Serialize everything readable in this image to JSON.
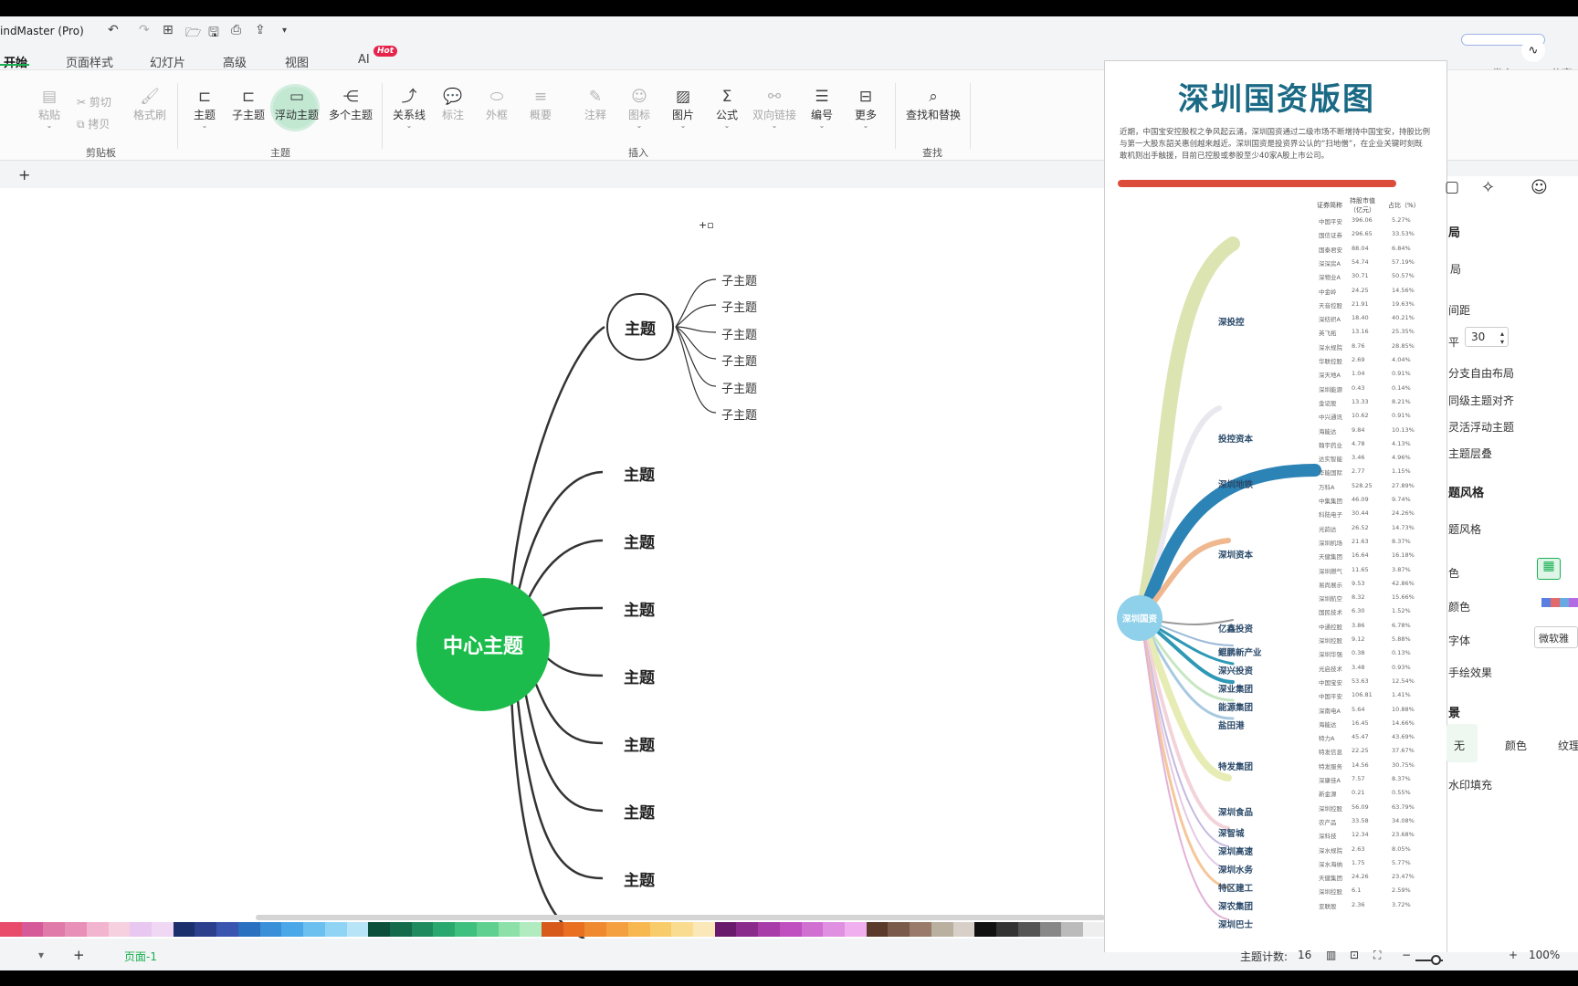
{
  "app": {
    "title": "indMaster (Pro)"
  },
  "quick_access": {
    "undo": "↶",
    "redo": "↷",
    "new": "⊞",
    "open": "🗁",
    "save": "🖫",
    "print": "⎙",
    "export": "⇪",
    "more": "▾"
  },
  "menu_tabs": [
    "开始",
    "页面样式",
    "幻灯片",
    "高级",
    "视图",
    "AI"
  ],
  "hot_badge": "Hot",
  "top_right": {
    "publish": "发布",
    "share": "分享"
  },
  "ribbon": {
    "clipboard": {
      "paste": "粘贴",
      "cut": "剪切",
      "copy": "拷贝",
      "format_painter": "格式刷",
      "label": "剪贴板"
    },
    "topic": {
      "topic": "主题",
      "subtopic": "子主题",
      "floating": "浮动主题",
      "multiple": "多个主题",
      "label": "主题"
    },
    "insert": {
      "relation": "关系线",
      "callout": "标注",
      "boundary": "外框",
      "summary": "概要",
      "note": "注释",
      "icon": "图标",
      "image": "图片",
      "formula": "公式",
      "link": "双向链接",
      "numbering": "编号",
      "more": "更多",
      "label": "插入"
    },
    "find": {
      "find_replace": "查找和替换",
      "label": "查找"
    }
  },
  "page_tab_add": "+",
  "mindmap": {
    "center": "中心主题",
    "topics": [
      "主题",
      "主题",
      "主题",
      "主题",
      "主题",
      "主题",
      "主题",
      "主题"
    ],
    "subtopics": [
      "子主题",
      "子主题",
      "子主题",
      "子主题",
      "子主题",
      "子主题"
    ]
  },
  "image_panel": {
    "title": "深圳国资版图",
    "intro": "近期，中国宝安控股权之争风起云涌，深圳国资通过二级市场不断增持中国宝安，持股比例与第一大股东韶关惠创越来越近。深圳国资是投资界公认的“扫地僧”，在企业关键时刻既敢机则出手触援，目前已控股或参股至少40家A股上市公司。",
    "center": "深圳国资",
    "table_headers": [
      "证券简称",
      "持股市值（亿元）",
      "占比（%）"
    ],
    "holders": [
      "深投控",
      "投控资本",
      "深圳地铁",
      "深圳资本",
      "亿鑫投资",
      "鲲鹏新产业",
      "深兴投资",
      "深业集团",
      "能源集团",
      "盐田港",
      "特发集团",
      "深圳食品",
      "深智城",
      "深圳高速",
      "深圳水务",
      "特区建工",
      "深农集团",
      "深圳巴士"
    ],
    "rows": [
      [
        "中国平安",
        "396.06",
        "5.27%"
      ],
      [
        "国信证券",
        "296.65",
        "33.53%"
      ],
      [
        "国泰君安",
        "88.04",
        "6.84%"
      ],
      [
        "深深房A",
        "54.74",
        "57.19%"
      ],
      [
        "深物业A",
        "30.71",
        "50.57%"
      ],
      [
        "中金岭",
        "24.25",
        "14.56%"
      ],
      [
        "天音控股",
        "21.91",
        "19.63%"
      ],
      [
        "深纺织A",
        "18.40",
        "40.21%"
      ],
      [
        "英飞拓",
        "13.16",
        "25.35%"
      ],
      [
        "深水规院",
        "8.76",
        "28.85%"
      ],
      [
        "华联控股",
        "2.69",
        "4.04%"
      ],
      [
        "深天地A",
        "1.04",
        "0.91%"
      ],
      [
        "深圳能源",
        "0.43",
        "0.14%"
      ],
      [
        "金证股",
        "13.33",
        "8.21%"
      ],
      [
        "中兴通讯",
        "10.62",
        "0.91%"
      ],
      [
        "海能达",
        "9.84",
        "10.13%"
      ],
      [
        "翰宇药业",
        "4.78",
        "4.13%"
      ],
      [
        "达实智能",
        "3.46",
        "4.96%"
      ],
      [
        "华能国际",
        "2.77",
        "1.15%"
      ],
      [
        "万科A",
        "528.25",
        "27.89%"
      ],
      [
        "中集集团",
        "46.09",
        "9.74%"
      ],
      [
        "科陆电子",
        "30.44",
        "24.26%"
      ],
      [
        "光韵达",
        "26.52",
        "14.73%"
      ],
      [
        "深圳机场",
        "21.63",
        "8.37%"
      ],
      [
        "天健集团",
        "16.64",
        "16.18%"
      ],
      [
        "深圳燃气",
        "11.65",
        "3.87%"
      ],
      [
        "易尚展示",
        "9.53",
        "42.86%"
      ],
      [
        "深圳航空",
        "8.32",
        "15.66%"
      ],
      [
        "国民技术",
        "6.30",
        "1.52%"
      ],
      [
        "中通控股",
        "3.86",
        "6.78%"
      ],
      [
        "深圳控股",
        "9.12",
        "5.88%"
      ],
      [
        "深圳华强",
        "0.38",
        "0.13%"
      ],
      [
        "光启技术",
        "3.48",
        "0.93%"
      ],
      [
        "中国宝安",
        "53.63",
        "12.54%"
      ],
      [
        "中国平安",
        "106.81",
        "1.41%"
      ],
      [
        "深南电A",
        "5.64",
        "10.88%"
      ],
      [
        "海能达",
        "16.45",
        "14.66%"
      ],
      [
        "特力A",
        "45.47",
        "43.69%"
      ],
      [
        "特发信息",
        "22.25",
        "37.67%"
      ],
      [
        "特发服务",
        "14.56",
        "30.75%"
      ],
      [
        "深康佳A",
        "7.57",
        "8.37%"
      ],
      [
        "新金源",
        "0.21",
        "0.55%"
      ],
      [
        "深圳控股",
        "56.09",
        "63.79%"
      ],
      [
        "农产品",
        "33.58",
        "34.08%"
      ],
      [
        "深科技",
        "12.34",
        "23.68%"
      ],
      [
        "深水规院",
        "2.63",
        "8.05%"
      ],
      [
        "深水海纳",
        "1.75",
        "5.77%"
      ],
      [
        "天健集团",
        "24.26",
        "23.47%"
      ],
      [
        "深圳控股",
        "6.1",
        "2.59%"
      ],
      [
        "亚联股",
        "2.36",
        "3.72%"
      ]
    ]
  },
  "right_panel": {
    "items": [
      "局",
      "局",
      "间距",
      "分支自由布局",
      "同级主题对齐",
      "灵活浮动主题",
      "主题层叠",
      "题风格",
      "题风格",
      "色",
      "颜色",
      "字体",
      "手绘效果",
      "景",
      "水印填充"
    ],
    "spacing_value": "30",
    "fill_options": [
      "无",
      "颜色",
      "纹理"
    ],
    "font_value": "微软雅"
  },
  "statusbar": {
    "page": "页面-1",
    "add": "+",
    "topic_count_label": "主题计数:",
    "topic_count": "16",
    "zoom": "100%"
  },
  "colors": {
    "accent": "#19b052",
    "center_node": "#1bbc4b",
    "hot": "#e6244b"
  }
}
